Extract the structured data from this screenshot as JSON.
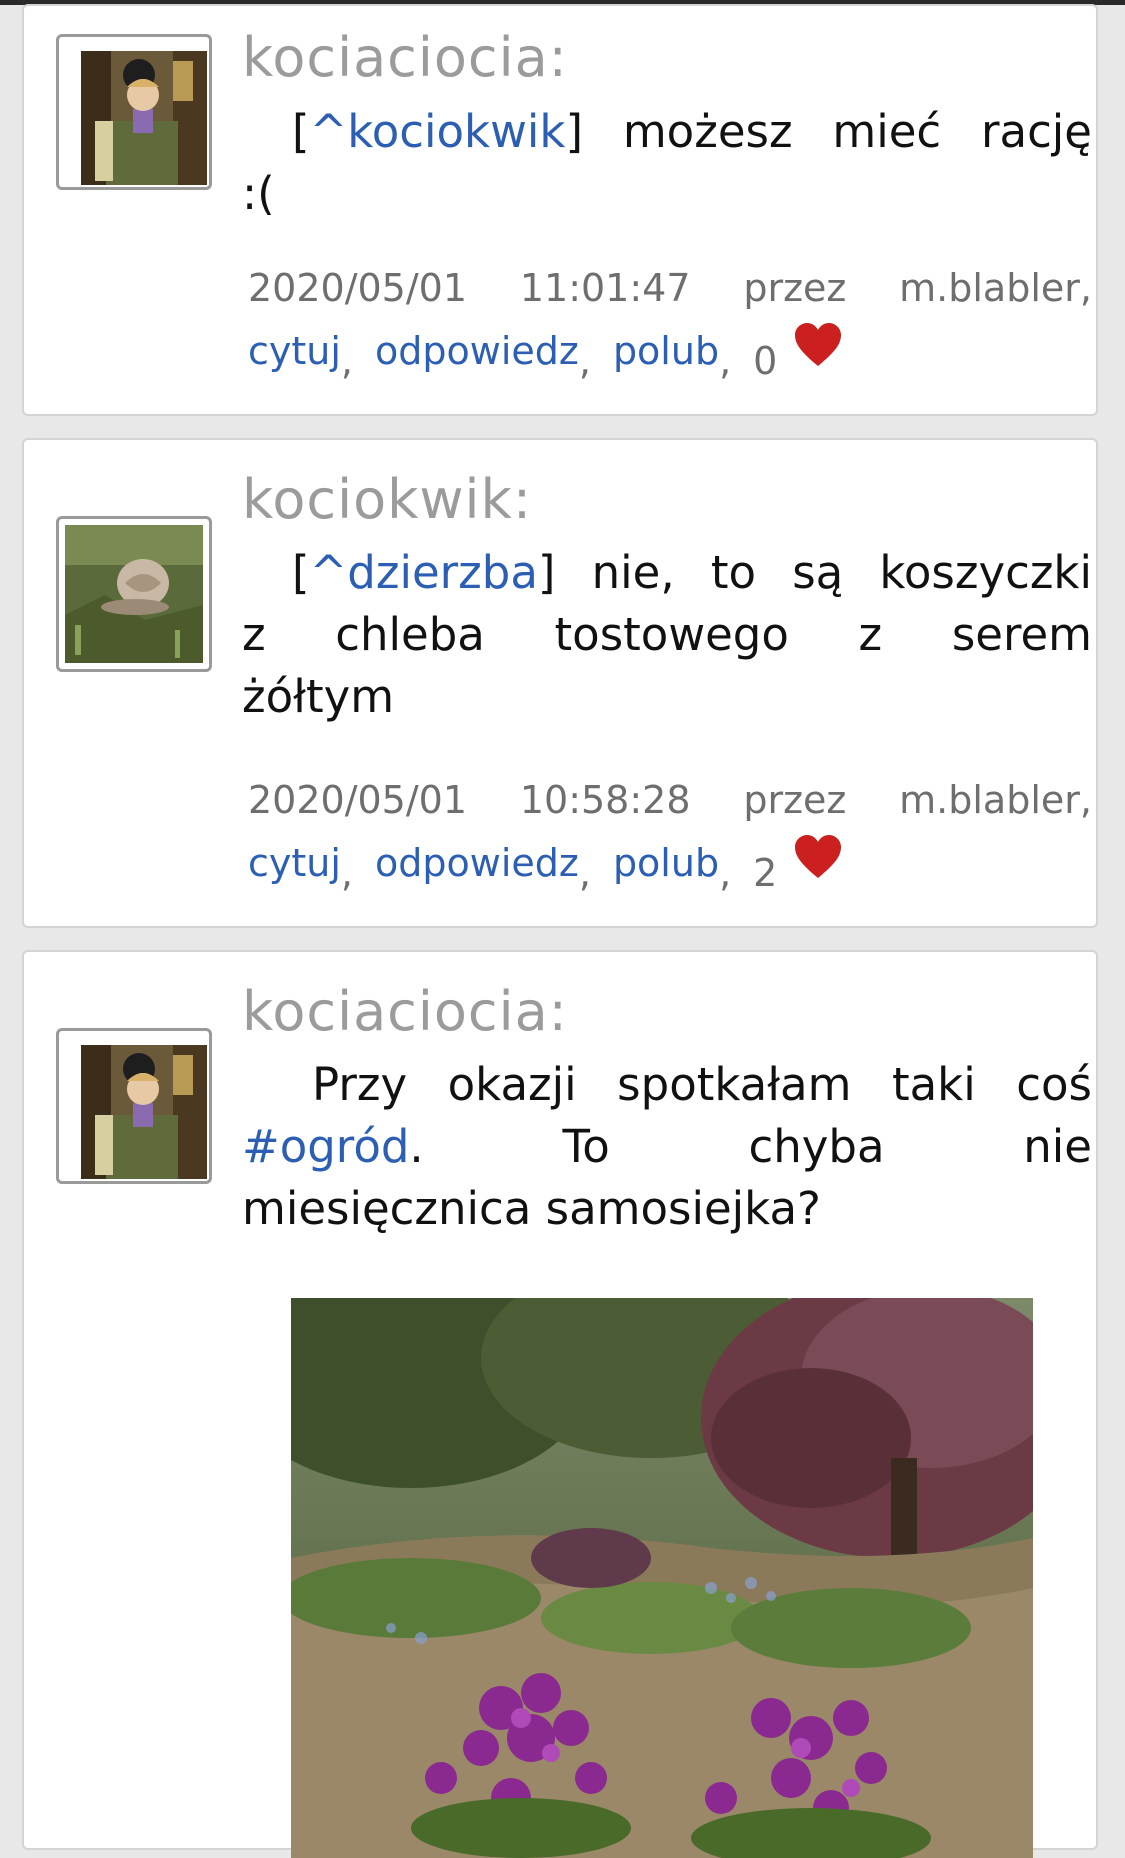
{
  "posts": [
    {
      "author": "kociaciocia:",
      "mention_prefix": "[",
      "mention": "^kociokwik",
      "mention_suffix": "] możesz mieć rację",
      "text_rest": ":(",
      "date": "2020/05/01",
      "time": "11:01:47",
      "via_label": "przez",
      "via": "m.blabler,",
      "actions": [
        "cytuj",
        "odpowiedz",
        "polub"
      ],
      "likes": "0"
    },
    {
      "author": "kociokwik:",
      "mention_prefix": "[",
      "mention": "^dzierzba",
      "mention_suffix": "] nie, to są koszyczki",
      "line2": "z chleba tostowego z serem",
      "line3": "żółtym",
      "date": "2020/05/01",
      "time": "10:58:28",
      "via_label": "przez",
      "via": "m.blabler,",
      "actions": [
        "cytuj",
        "odpowiedz",
        "polub"
      ],
      "likes": "2"
    },
    {
      "author": "kociaciocia:",
      "line1": "Przy okazji spotkałam taki coś",
      "hashtag": "#ogród",
      "line2_rest": ". To chyba nie",
      "line3": "miesięcznica samosiejka?"
    }
  ],
  "colors": {
    "link": "#2c5fb3",
    "author": "#9b9b9b",
    "heart": "#cc1f1f",
    "card_border": "#d4d4d4",
    "page_bg": "#e8e8e8"
  },
  "icons": {
    "heart": "heart-icon"
  }
}
